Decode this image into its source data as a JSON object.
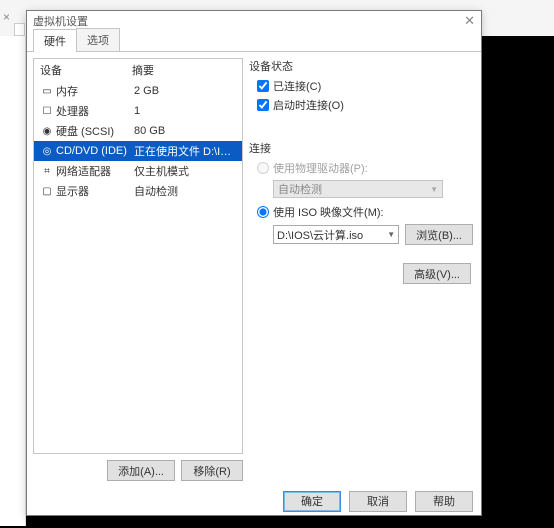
{
  "window": {
    "title": "虚拟机设置",
    "close_glyph": "✕"
  },
  "tabs": {
    "hardware": "硬件",
    "options": "选项"
  },
  "columns": {
    "device": "设备",
    "summary": "摘要"
  },
  "devices": [
    {
      "icon": "memory-icon",
      "name": "内存",
      "summary": "2 GB"
    },
    {
      "icon": "cpu-icon",
      "name": "处理器",
      "summary": "1"
    },
    {
      "icon": "disk-icon",
      "name": "硬盘 (SCSI)",
      "summary": "80 GB"
    },
    {
      "icon": "cd-icon",
      "name": "CD/DVD (IDE)",
      "summary": "正在使用文件 D:\\IOS\\云计算..."
    },
    {
      "icon": "network-icon",
      "name": "网络适配器",
      "summary": "仅主机模式"
    },
    {
      "icon": "display-icon",
      "name": "显示器",
      "summary": "自动检测"
    }
  ],
  "selected_device_index": 3,
  "buttons": {
    "add": "添加(A)...",
    "remove": "移除(R)",
    "browse": "浏览(B)...",
    "advanced": "高级(V)...",
    "ok": "确定",
    "cancel": "取消",
    "help": "帮助"
  },
  "status": {
    "title": "设备状态",
    "connected": "已连接(C)",
    "connect_on_start": "启动时连接(O)"
  },
  "connection": {
    "title": "连接",
    "physical_label": "使用物理驱动器(P):",
    "physical_combo_value": "自动检测",
    "iso_label": "使用 ISO 映像文件(M):",
    "iso_path": "D:\\IOS\\云计算.iso"
  }
}
